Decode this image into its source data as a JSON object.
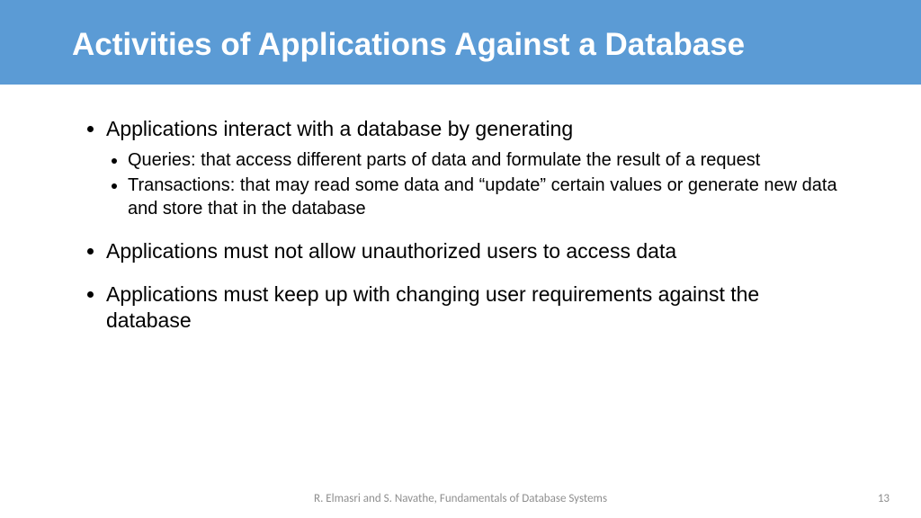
{
  "header": {
    "title": "Activities of Applications Against a Database"
  },
  "bullets": {
    "b1": "Applications interact with a database by generating",
    "b1_sub1": "Queries: that access different parts of data and formulate the result of a request",
    "b1_sub2": "Transactions: that may read some data and “update” certain values or generate new data and store that in the database",
    "b2": "Applications must not allow unauthorized users to access data",
    "b3": "Applications must keep up with changing user requirements against the database"
  },
  "footer": {
    "citation": "R. Elmasri and S. Navathe, Fundamentals of Database Systems",
    "page": "13"
  }
}
